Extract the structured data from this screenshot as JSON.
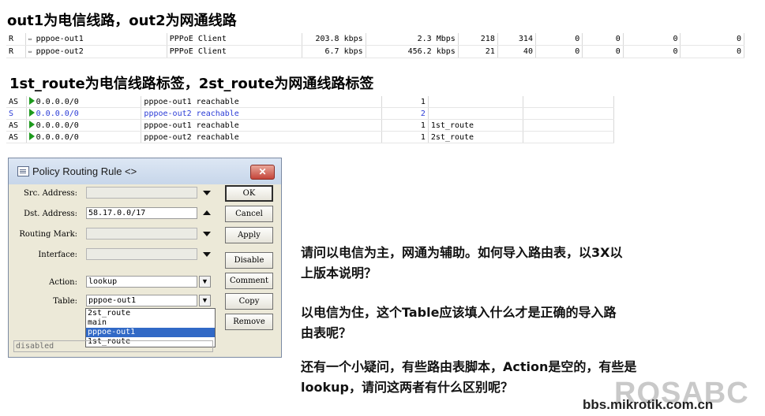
{
  "heading1": "out1为电信线路，out2为网通线路",
  "interfaces": [
    {
      "flag": "R",
      "name": "pppoe-out1",
      "type": "PPPoE Client",
      "tx": "203.8 kbps",
      "rx": "2.3 Mbps",
      "tx_pkt": "218",
      "rx_pkt": "314",
      "c1": "0",
      "c2": "0",
      "c3": "0",
      "c4": "0"
    },
    {
      "flag": "R",
      "name": "pppoe-out2",
      "type": "PPPoE Client",
      "tx": "6.7 kbps",
      "rx": "456.2 kbps",
      "tx_pkt": "21",
      "rx_pkt": "40",
      "c1": "0",
      "c2": "0",
      "c3": "0",
      "c4": "0"
    }
  ],
  "heading2": "1st_route为电信线路标签，2st_route为网通线路标签",
  "routes": [
    {
      "flag": "AS",
      "dst": "0.0.0.0/0",
      "gateway": "pppoe-out1 reachable",
      "distance": "1",
      "mark": "",
      "highlight": false
    },
    {
      "flag": "S",
      "dst": "0.0.0.0/0",
      "gateway": "pppoe-out2 reachable",
      "distance": "2",
      "mark": "",
      "highlight": true
    },
    {
      "flag": "AS",
      "dst": "0.0.0.0/0",
      "gateway": "pppoe-out1 reachable",
      "distance": "1",
      "mark": "1st_route",
      "highlight": false
    },
    {
      "flag": "AS",
      "dst": "0.0.0.0/0",
      "gateway": "pppoe-out2 reachable",
      "distance": "1",
      "mark": "2st_route",
      "highlight": false
    }
  ],
  "dialog": {
    "title": "Policy Routing Rule <>",
    "close_label": "✕",
    "labels": {
      "src": "Src. Address:",
      "dst": "Dst. Address:",
      "mark": "Routing Mark:",
      "iface": "Interface:",
      "action": "Action:",
      "table": "Table:"
    },
    "values": {
      "src": "",
      "dst": "58.17.0.0/17",
      "mark": "",
      "iface": "",
      "action": "lookup",
      "table": "pppoe-out1"
    },
    "buttons": {
      "ok": "OK",
      "cancel": "Cancel",
      "apply": "Apply",
      "disable": "Disable",
      "comment": "Comment",
      "copy": "Copy",
      "remove": "Remove"
    },
    "status": "disabled",
    "table_options": [
      "2st_route",
      "main",
      "pppoe-out1",
      "1st_route"
    ],
    "table_selected_index": 2
  },
  "questions": {
    "q1_line1": "请问以电信为主，网通为辅助。如何导入路由表，以3X以",
    "q1_line2": "上版本说明？",
    "q2_line1": "以电信为住，这个Table应该填入什么才是正确的导入路",
    "q2_line2": "由表呢？",
    "q3_line1": "还有一个小疑问，有些路由表脚本，Action是空的，有些是",
    "q3_line2": "lookup，请问这两者有什么区别呢？"
  },
  "watermark": {
    "logo": "ROSABC",
    "url": "bbs.mikrotik.com.cn"
  },
  "colors": {
    "route_highlight": "#2a3bd6",
    "route_active_icon": "#1d9a1d",
    "selection": "#3169c6"
  }
}
